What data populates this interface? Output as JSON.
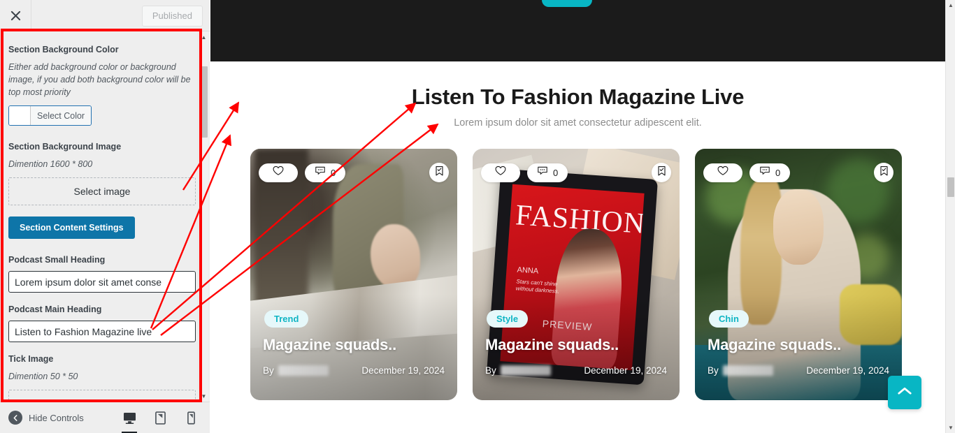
{
  "customizer": {
    "close_icon": "close-icon",
    "publish_button": "Published",
    "panel": {
      "bg_color": {
        "label": "Section Background Color",
        "description": "Either add background color or background image, if you add both background color will be top most priority",
        "select_color_label": "Select Color",
        "swatch_color": "#ffffff"
      },
      "bg_image": {
        "label": "Section Background Image",
        "dimension": "Dimention 1600 * 800",
        "select_image_label": "Select image"
      },
      "content_settings_button": "Section Content Settings",
      "small_heading": {
        "label": "Podcast Small Heading",
        "value": "Lorem ipsum dolor sit amet conse"
      },
      "main_heading": {
        "label": "Podcast Main Heading",
        "value": "Listen to Fashion Magazine live"
      },
      "tick_image": {
        "label": "Tick Image",
        "dimension": "Dimention 50 * 50"
      }
    },
    "footer": {
      "hide_controls_label": "Hide Controls",
      "devices": [
        {
          "name": "desktop-preview-button",
          "icon": "desktop-icon",
          "active": true
        },
        {
          "name": "tablet-preview-button",
          "icon": "tablet-icon",
          "active": false
        },
        {
          "name": "mobile-preview-button",
          "icon": "mobile-icon",
          "active": false
        }
      ]
    }
  },
  "preview": {
    "section": {
      "title": "Listen To Fashion Magazine Live",
      "subtitle": "Lorem ipsum dolor sit amet consectetur adipescent elit."
    },
    "cards": [
      {
        "tag": "Trend",
        "title": "Magazine squads..",
        "by_label": "By",
        "date": "December 19, 2024",
        "comment_count": "0",
        "like_icon": "heart-icon",
        "comment_icon": "comment-icon",
        "bookmark_icon": "bookmark-check-icon"
      },
      {
        "tag": "Style",
        "title": "Magazine squads..",
        "by_label": "By",
        "date": "December 19, 2024",
        "comment_count": "0",
        "like_icon": "heart-icon",
        "comment_icon": "comment-icon",
        "bookmark_icon": "bookmark-check-icon"
      },
      {
        "tag": "Chin",
        "title": "Magazine squads..",
        "by_label": "By",
        "date": "December 19, 2024",
        "comment_count": "0",
        "like_icon": "heart-icon",
        "comment_icon": "comment-icon",
        "bookmark_icon": "bookmark-check-icon"
      }
    ],
    "magazine_cover": {
      "brand": "FASHION",
      "name": "ANNA",
      "quote": "Stars can't shine without darkness.",
      "feature": "PREVIEW"
    },
    "scroll_top_icon": "chevron-up-icon"
  },
  "colors": {
    "accent_teal": "#08b6c4",
    "tag_text": "#0fb5c4",
    "tag_bg": "#e6f8fa",
    "primary_button": "#0e75a8",
    "annotation_red": "#ff0000",
    "dark_band": "#1b1b1b"
  }
}
